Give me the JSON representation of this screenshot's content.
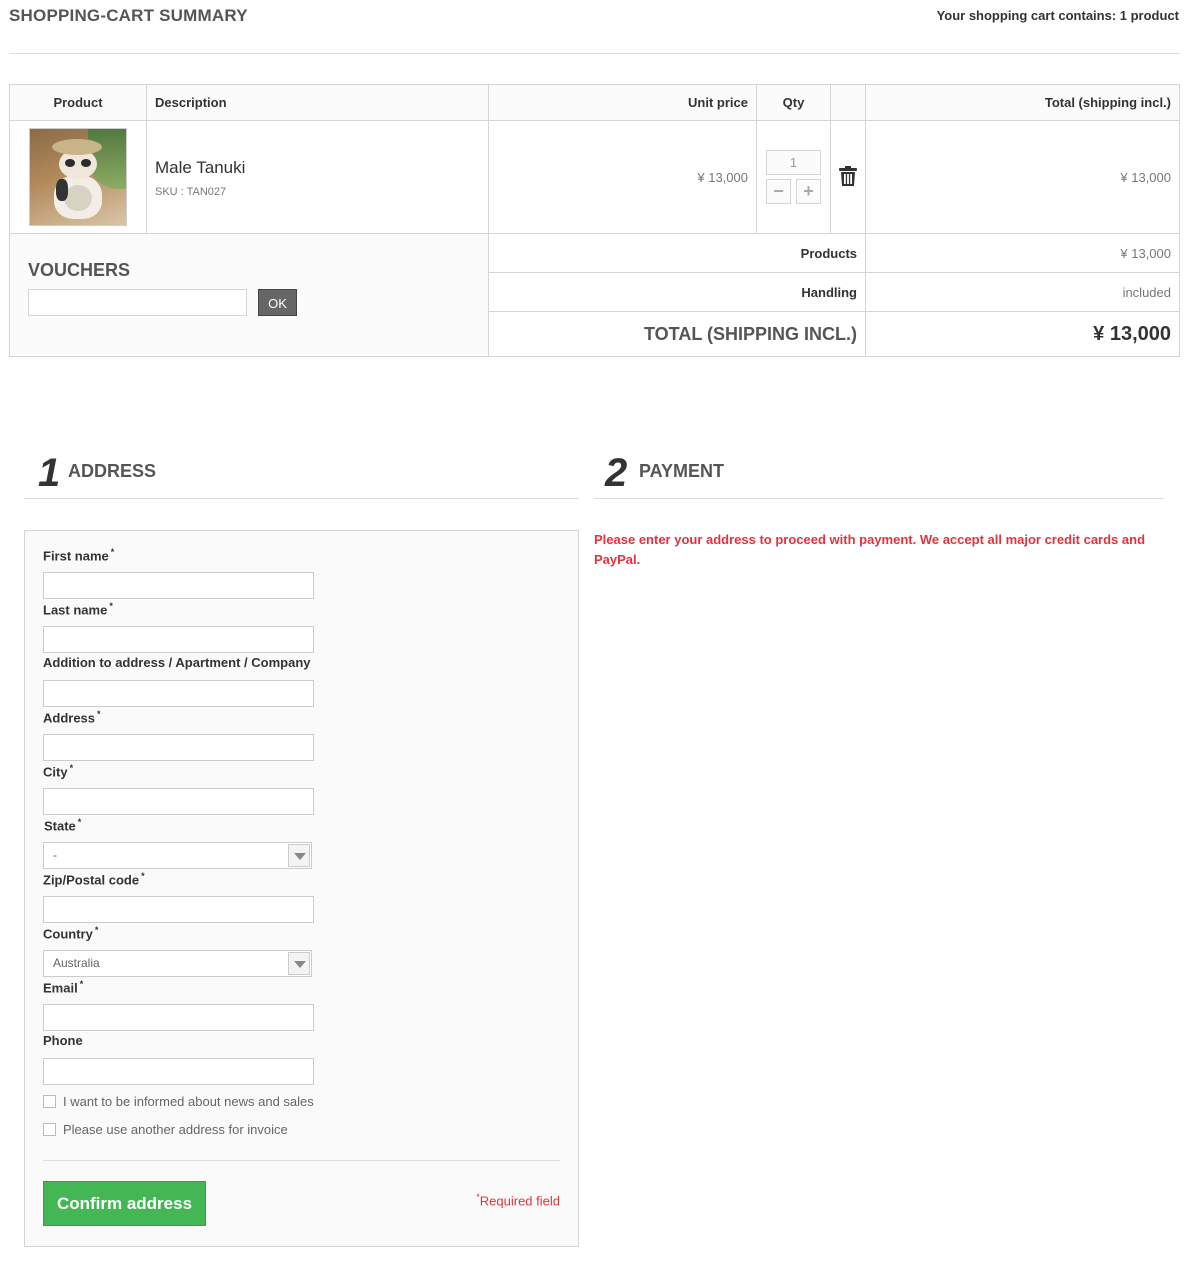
{
  "header": {
    "title": "SHOPPING-CART SUMMARY",
    "cart_count": "Your shopping cart contains: 1 product"
  },
  "cart": {
    "columns": {
      "product": "Product",
      "description": "Description",
      "unit_price": "Unit price",
      "qty": "Qty",
      "total": "Total (shipping incl.)"
    },
    "items": [
      {
        "name": "Male Tanuki",
        "sku": "SKU : TAN027",
        "unit_price": "¥ 13,000",
        "qty": "1",
        "total": "¥ 13,000"
      }
    ]
  },
  "vouchers": {
    "title": "VOUCHERS",
    "input_value": "",
    "ok_label": "OK"
  },
  "summary": {
    "products_label": "Products",
    "products_value": "¥ 13,000",
    "handling_label": "Handling",
    "handling_value": "included",
    "total_label": "TOTAL (SHIPPING INCL.)",
    "total_value": "¥ 13,000"
  },
  "steps": {
    "address": {
      "number": "1",
      "title": "ADDRESS"
    },
    "payment": {
      "number": "2",
      "title": "PAYMENT"
    }
  },
  "payment": {
    "message": "Please enter your address to proceed with payment. We accept all major credit cards and PayPal."
  },
  "form": {
    "first_name_label": "First name",
    "last_name_label": "Last name",
    "addition_label": "Addition to address / Apartment / Company",
    "address_label": "Address",
    "city_label": "City",
    "state_label": "State",
    "state_value": "-",
    "zip_label": "Zip/Postal code",
    "country_label": "Country",
    "country_value": "Australia",
    "email_label": "Email",
    "phone_label": "Phone",
    "newsletter_label": "I want to be informed about news and sales",
    "invoice_label": "Please use another address for invoice",
    "confirm_label": "Confirm address",
    "required_mark": "*",
    "required_note": "Required field"
  },
  "colors": {
    "accent_green": "#43b754",
    "error_red": "#e2333c"
  }
}
